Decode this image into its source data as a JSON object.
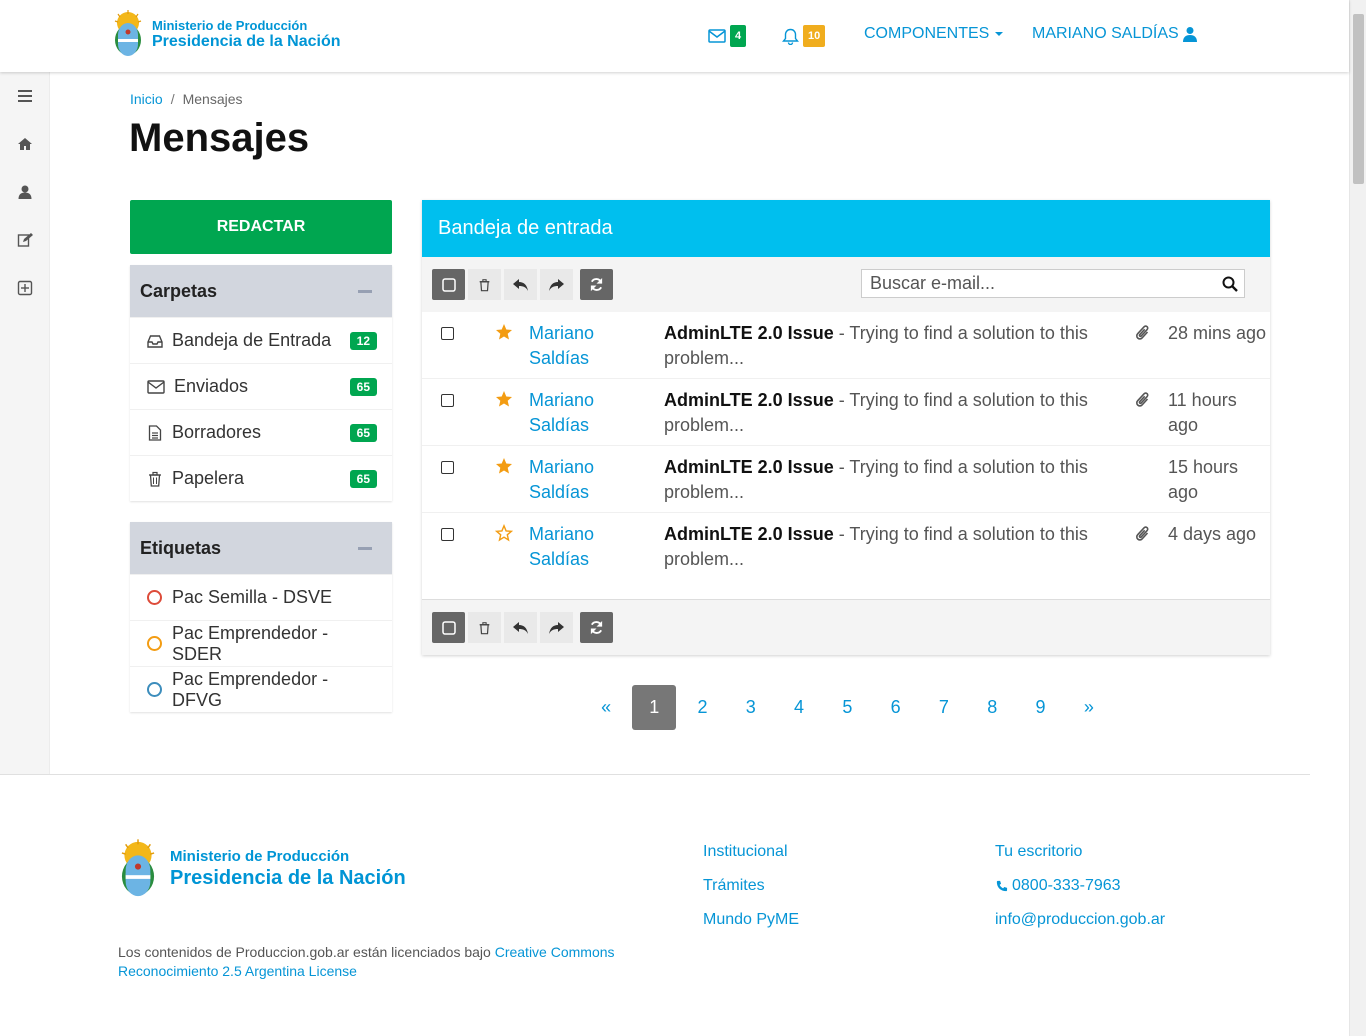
{
  "header": {
    "logo": {
      "line1": "Ministerio de Producción",
      "line2": "Presidencia de la Nación"
    },
    "mail_badge": "4",
    "bell_badge": "10",
    "components_label": "COMPONENTES",
    "user_label": "MARIANO SALDÍAS",
    "colors": {
      "link": "#0695d6",
      "mail_badge": "#00a650",
      "bell_badge": "#f0ad1e"
    }
  },
  "sidebar": {
    "icons": [
      "bars-icon",
      "home-icon",
      "user-icon",
      "edit-icon",
      "plus-square-icon"
    ]
  },
  "breadcrumb": {
    "home": "Inicio",
    "separator": "/",
    "current": "Mensajes"
  },
  "page_title": "Mensajes",
  "compose_label": "REDACTAR",
  "folders": {
    "title": "Carpetas",
    "items": [
      {
        "label": "Bandeja de Entrada",
        "count": "12",
        "icon": "inbox-icon"
      },
      {
        "label": "Enviados",
        "count": "65",
        "icon": "envelope-icon"
      },
      {
        "label": "Borradores",
        "count": "65",
        "icon": "file-text-icon"
      },
      {
        "label": "Papelera",
        "count": "65",
        "icon": "trash-icon"
      }
    ]
  },
  "labels": {
    "title": "Etiquetas",
    "items": [
      {
        "label": "Pac Semilla - DSVE",
        "color": "#dd4b39"
      },
      {
        "label": "Pac Emprendedor - SDER",
        "color": "#f39c12"
      },
      {
        "label": "Pac Emprendedor - DFVG",
        "color": "#3c8dbc"
      }
    ]
  },
  "inbox": {
    "title": "Bandeja de entrada",
    "search_placeholder": "Buscar e-mail...",
    "accent": "#00bfee",
    "messages": [
      {
        "sender": "Mariano Saldías",
        "subject": "AdminLTE 2.0 Issue",
        "preview": " - Trying to find a solution to this problem...",
        "time": "28 mins ago",
        "starred": true,
        "attachment": true
      },
      {
        "sender": "Mariano Saldías",
        "subject": "AdminLTE 2.0 Issue",
        "preview": " - Trying to find a solution to this problem...",
        "time": "11 hours ago",
        "starred": true,
        "attachment": true
      },
      {
        "sender": "Mariano Saldías",
        "subject": "AdminLTE 2.0 Issue",
        "preview": " - Trying to find a solution to this problem...",
        "time": "15 hours ago",
        "starred": true,
        "attachment": false
      },
      {
        "sender": "Mariano Saldías",
        "subject": "AdminLTE 2.0 Issue",
        "preview": " - Trying to find a solution to this problem...",
        "time": "4 days ago",
        "starred": false,
        "attachment": true
      }
    ]
  },
  "pagination": {
    "prev": "«",
    "pages": [
      "1",
      "2",
      "3",
      "4",
      "5",
      "6",
      "7",
      "8",
      "9"
    ],
    "next": "»",
    "current": "1"
  },
  "footer": {
    "logo": {
      "line1": "Ministerio de Producción",
      "line2": "Presidencia de la Nación"
    },
    "license_text": "Los contenidos de Produccion.gob.ar están licenciados bajo ",
    "license_link": "Creative Commons Reconocimiento 2.5 Argentina License",
    "col1": [
      "Institucional",
      "Trámites",
      "Mundo PyME"
    ],
    "col2_title": "Tu escritorio",
    "phone": "0800-333-7963",
    "email": "info@produccion.gob.ar"
  }
}
